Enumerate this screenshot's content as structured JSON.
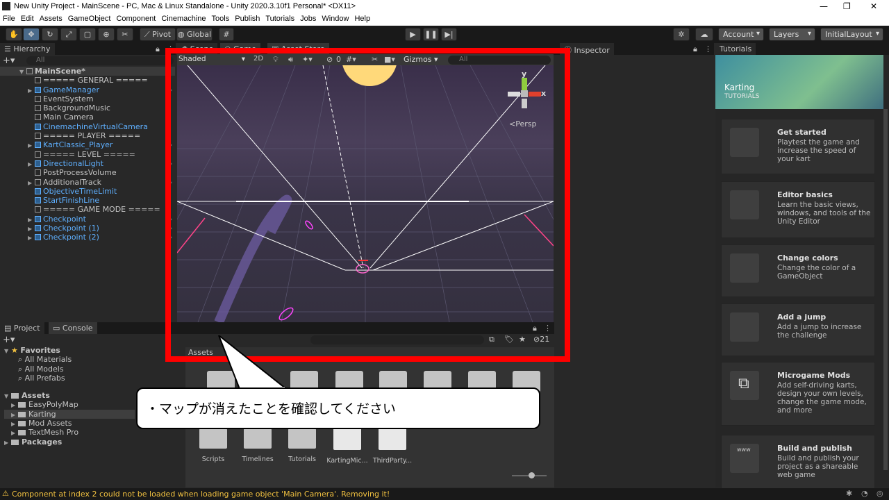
{
  "window": {
    "title": "New Unity Project - MainScene - PC, Mac & Linux Standalone - Unity 2020.3.10f1 Personal* <DX11>"
  },
  "menu": [
    "File",
    "Edit",
    "Assets",
    "GameObject",
    "Component",
    "Cinemachine",
    "Tools",
    "Publish",
    "Tutorials",
    "Jobs",
    "Window",
    "Help"
  ],
  "toolbar": {
    "pivot": "Pivot",
    "global": "Global",
    "account": "Account",
    "layers": "Layers",
    "layout": "InitialLayout"
  },
  "hierarchy": {
    "tab": "Hierarchy",
    "search_placeholder": "All",
    "scene": "MainScene*",
    "items": [
      {
        "label": "===== GENERAL =====",
        "prefab": false,
        "expand": false
      },
      {
        "label": "GameManager",
        "prefab": true,
        "expand": true
      },
      {
        "label": "EventSystem",
        "prefab": false,
        "expand": false
      },
      {
        "label": "BackgroundMusic",
        "prefab": false,
        "expand": false
      },
      {
        "label": "Main Camera",
        "prefab": false,
        "expand": false
      },
      {
        "label": "CinemachineVirtualCamera",
        "prefab": true,
        "expand": false
      },
      {
        "label": "===== PLAYER =====",
        "prefab": false,
        "expand": false
      },
      {
        "label": "KartClassic_Player",
        "prefab": true,
        "expand": true
      },
      {
        "label": "===== LEVEL =====",
        "prefab": false,
        "expand": false
      },
      {
        "label": "DirectionalLight",
        "prefab": true,
        "expand": true
      },
      {
        "label": "PostProcessVolume",
        "prefab": false,
        "expand": false
      },
      {
        "label": "AdditionalTrack",
        "prefab": false,
        "expand": true
      },
      {
        "label": "ObjectiveTimeLimit",
        "prefab": true,
        "expand": false
      },
      {
        "label": "StartFinishLine",
        "prefab": true,
        "expand": false
      },
      {
        "label": "===== GAME MODE =====",
        "prefab": false,
        "expand": false
      },
      {
        "label": "Checkpoint",
        "prefab": true,
        "expand": true
      },
      {
        "label": "Checkpoint (1)",
        "prefab": true,
        "expand": true
      },
      {
        "label": "Checkpoint (2)",
        "prefab": true,
        "expand": true
      }
    ]
  },
  "scene": {
    "tab": "Scene",
    "tab2": "Game",
    "tab3": "Asset Store",
    "shading": "Shaded",
    "mode2d": "2D",
    "gizmos": "Gizmos",
    "search_placeholder": "All",
    "hidden_count": "0",
    "persp": "Persp",
    "axis_y": "y",
    "axis_x": "x"
  },
  "inspector": {
    "tab": "Inspector"
  },
  "project": {
    "tab": "Project",
    "tab2": "Console",
    "hidden_count": "21",
    "favorites_label": "Favorites",
    "favorites": [
      "All Materials",
      "All Models",
      "All Prefabs"
    ],
    "assets_label": "Assets",
    "folders": [
      "EasyPolyMap",
      "Karting",
      "Mod Assets",
      "TextMesh Pro"
    ],
    "packages_label": "Packages",
    "breadcrumb": "Assets",
    "grid_items": [
      "Scripts",
      "Timelines",
      "Tutorials",
      "KartingMic...",
      "ThirdParty..."
    ]
  },
  "tutorials": {
    "tab": "Tutorials",
    "banner_title": "Karting",
    "banner_sub": "TUTORIALS",
    "cards": [
      {
        "title": "Get started",
        "desc": "Playtest the game and increase the speed of your kart"
      },
      {
        "title": "Editor basics",
        "desc": "Learn the basic views, windows, and tools of the Unity Editor"
      },
      {
        "title": "Change colors",
        "desc": "Change the color of a GameObject"
      },
      {
        "title": "Add a jump",
        "desc": "Add a jump to increase the challenge"
      },
      {
        "title": "Microgame Mods",
        "desc": "Add self-driving karts, design your own levels, change the game mode, and more"
      },
      {
        "title": "Build and publish",
        "desc": "Build and publish your project as a shareable web game"
      }
    ],
    "www": "www"
  },
  "callout": {
    "text": "・マップが消えたことを確認してください"
  },
  "status": {
    "message": "Component at index 2 could not be loaded when loading game object 'Main Camera'. Removing it!"
  },
  "colors": {
    "highlight": "#ff0000",
    "prefab_blue": "#5fb0ff",
    "accent": "#4a6a8a"
  }
}
